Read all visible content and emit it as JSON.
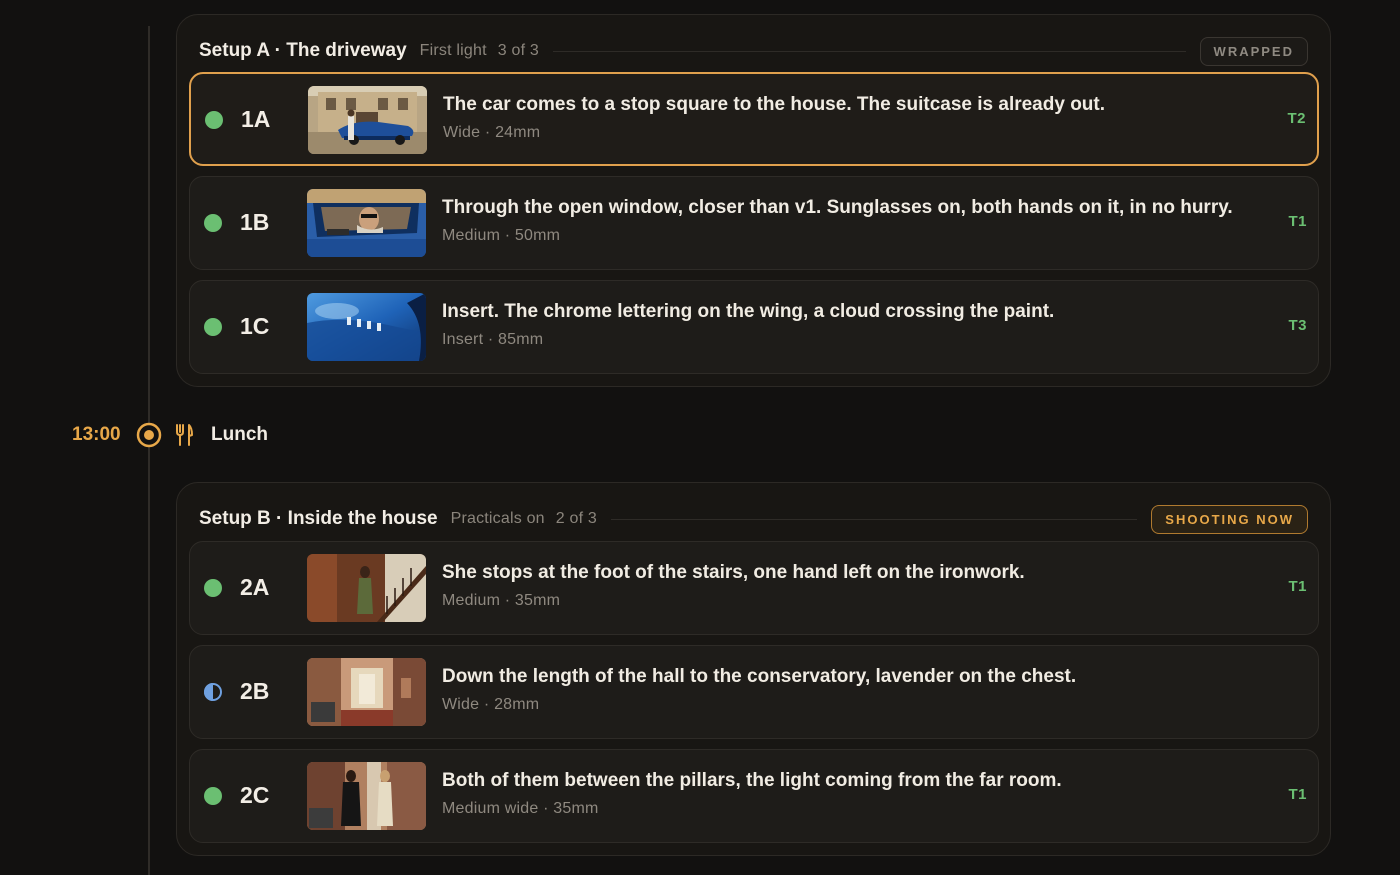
{
  "lunch": {
    "time": "13:00",
    "label": "Lunch",
    "icon": "fork-knife-icon"
  },
  "colors": {
    "accent": "#e8a849",
    "done": "#6bbf72",
    "partial": "#6fa0e0",
    "panel": "#181613",
    "card": "#1e1c19"
  },
  "setups": [
    {
      "title": "Setup A · The driveway",
      "subtitle": "First light",
      "count": "3 of 3",
      "badge": "WRAPPED",
      "shots": [
        {
          "num": "1A",
          "status": "done",
          "desc": "The car comes to a stop square to the house. The suitcase is already out.",
          "lens": "Wide · 24mm",
          "take": "T2",
          "selected": true
        },
        {
          "num": "1B",
          "status": "done",
          "desc": "Through the open window, closer than v1. Sunglasses on, both hands on it, in no hurry.",
          "lens": "Medium · 50mm",
          "take": "T1"
        },
        {
          "num": "1C",
          "status": "done",
          "desc": "Insert. The chrome lettering on the wing, a cloud crossing the paint.",
          "lens": "Insert · 85mm",
          "take": "T3"
        }
      ]
    },
    {
      "title": "Setup B · Inside the house",
      "subtitle": "Practicals on",
      "count": "2 of 3",
      "badge": "SHOOTING NOW",
      "shots": [
        {
          "num": "2A",
          "status": "done",
          "desc": "She stops at the foot of the stairs, one hand left on the ironwork.",
          "lens": "Medium · 35mm",
          "take": "T1"
        },
        {
          "num": "2B",
          "status": "in-progress",
          "desc": "Down the length of the hall to the conservatory, lavender on the chest.",
          "lens": "Wide · 28mm",
          "take": ""
        },
        {
          "num": "2C",
          "status": "done",
          "desc": "Both of them between the pillars, the light coming from the far room.",
          "lens": "Medium wide · 35mm",
          "take": "T1"
        }
      ]
    }
  ]
}
